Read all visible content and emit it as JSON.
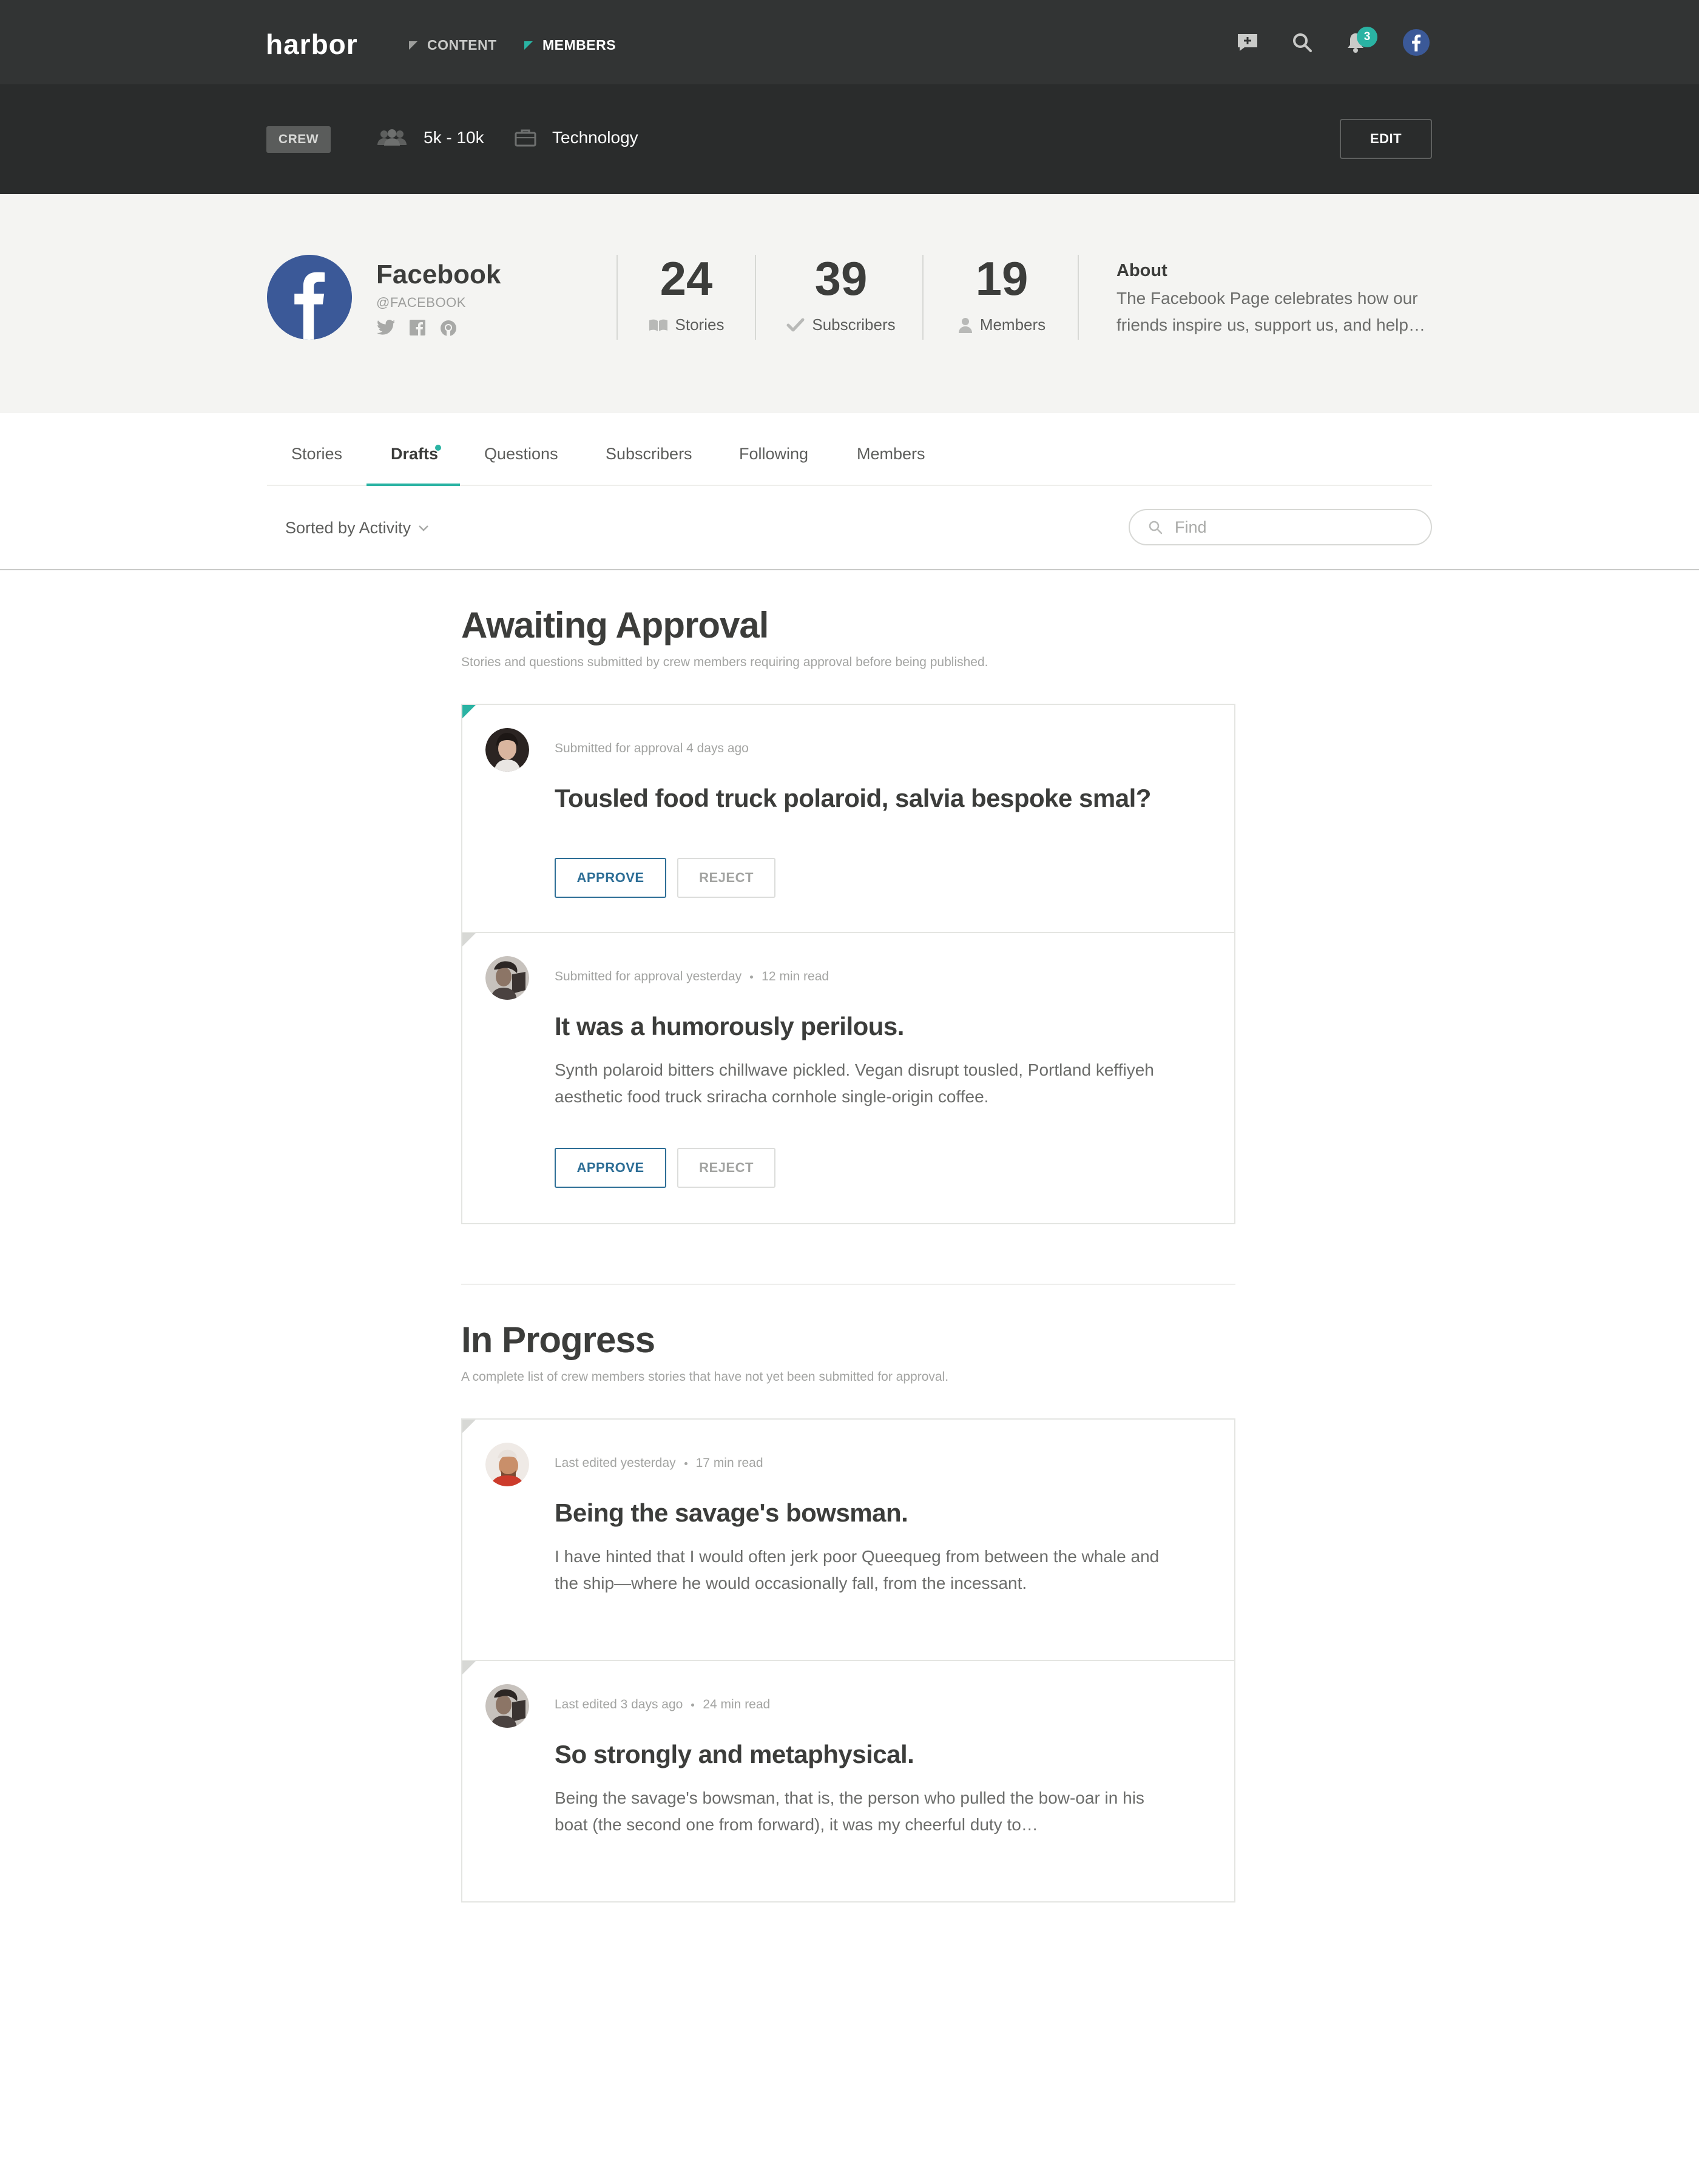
{
  "nav": {
    "logo": "harbor",
    "links": [
      {
        "label": "CONTENT"
      },
      {
        "label": "MEMBERS"
      }
    ],
    "notification_count": "3"
  },
  "crew_bar": {
    "tag": "CREW",
    "size": "5k - 10k",
    "category": "Technology",
    "edit_label": "EDIT"
  },
  "profile": {
    "name": "Facebook",
    "handle": "@FACEBOOK",
    "stats": [
      {
        "value": "24",
        "label": "Stories"
      },
      {
        "value": "39",
        "label": "Subscribers"
      },
      {
        "value": "19",
        "label": "Members"
      }
    ],
    "about_heading": "About",
    "about_text": "The Facebook Page celebrates how our friends inspire us, support us, and help…"
  },
  "tabs": [
    "Stories",
    "Drafts",
    "Questions",
    "Subscribers",
    "Following",
    "Members"
  ],
  "toolbar": {
    "sort_label": "Sorted by Activity",
    "find_placeholder": "Find"
  },
  "awaiting": {
    "title": "Awaiting Approval",
    "subtitle": "Stories and questions submitted by crew members requiring approval before being published.",
    "cards": [
      {
        "meta": "Submitted for approval 4 days ago",
        "title": "Tousled food truck polaroid, salvia bespoke smal?",
        "approve": "APPROVE",
        "reject": "REJECT"
      },
      {
        "meta": "Submitted for approval yesterday",
        "read": "12 min read",
        "title": "It was a humorously perilous.",
        "body": "Synth polaroid bitters chillwave pickled. Vegan disrupt tousled, Portland keffiyeh aesthetic food truck sriracha cornhole single-origin coffee.",
        "approve": "APPROVE",
        "reject": "REJECT"
      }
    ]
  },
  "in_progress": {
    "title": "In Progress",
    "subtitle": "A complete list of crew members stories that have not yet been submitted for approval.",
    "cards": [
      {
        "meta": "Last edited yesterday",
        "read": "17 min read",
        "title": "Being the savage's bowsman.",
        "body": "I have hinted that I would often jerk poor Queequeg from between the whale and the ship—where he would occasionally fall, from the incessant."
      },
      {
        "meta": "Last edited 3 days ago",
        "read": "24 min read",
        "title": "So strongly and metaphysical.",
        "body": "Being the savage's bowsman, that is, the person who pulled the bow-oar in his boat (the second one from forward), it was my cheerful duty to…"
      }
    ]
  },
  "colors": {
    "accent": "#2ab3a3",
    "approve": "#2d6e96",
    "facebook": "#3b5998",
    "nav_bg": "#323434",
    "crewbar_bg": "#2a2c2c"
  }
}
